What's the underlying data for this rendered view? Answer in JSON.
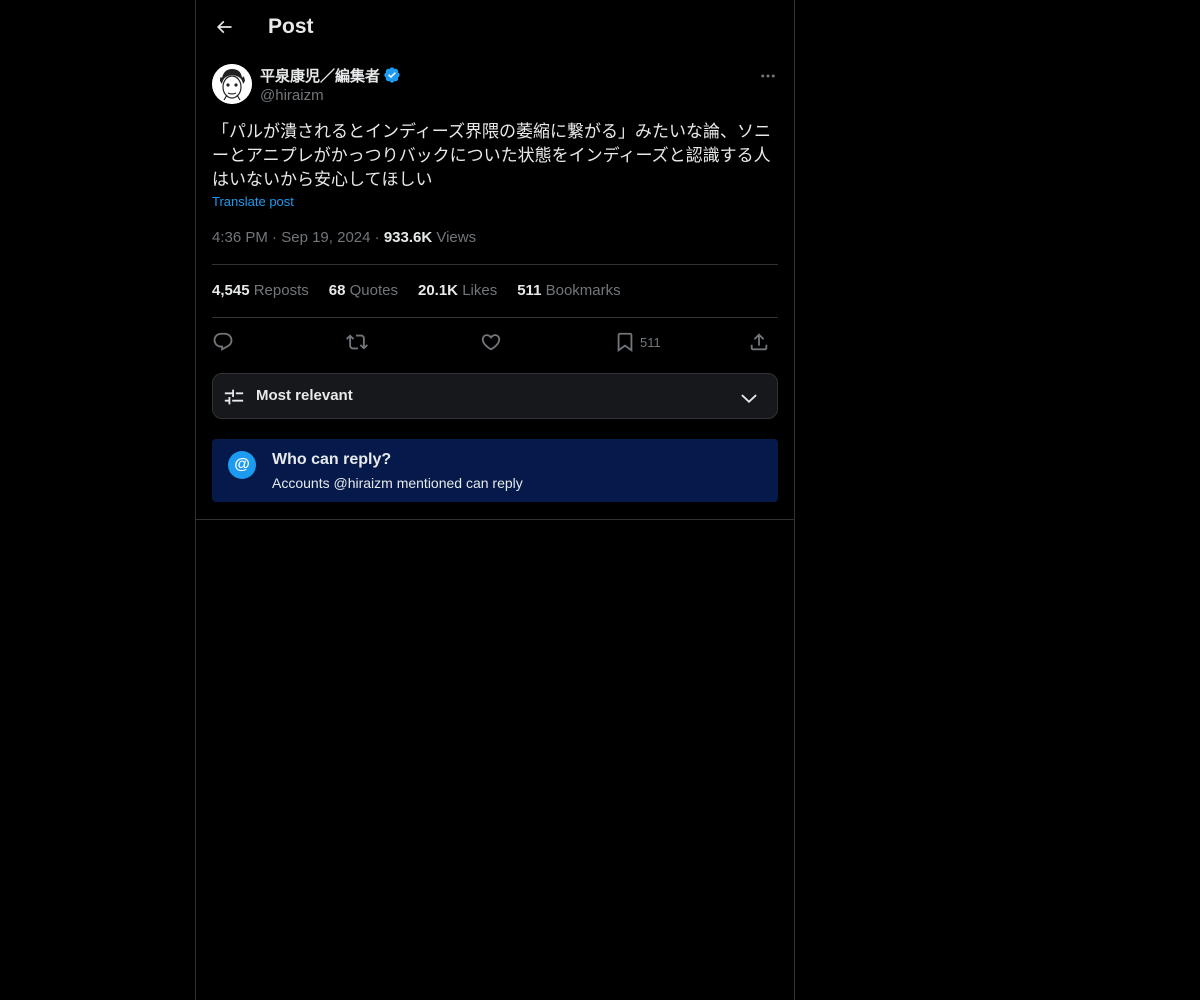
{
  "header": {
    "title": "Post",
    "back_icon": "arrow-left-icon"
  },
  "post": {
    "display_name": "平泉康児／編集者",
    "verified": true,
    "handle": "@hiraizm",
    "text": "「パルが潰されるとインディーズ界隈の萎縮に繋がる」みたいな論、ソニーとアニプレがかっつりバックについた状態をインディーズと認識する人はいないから安心してほしい",
    "translate_label": "Translate post",
    "time": "4:36 PM",
    "date": "Sep 19, 2024",
    "views_count": "933.6K",
    "views_label": "Views"
  },
  "stats": [
    {
      "num": "4,545",
      "label": "Reposts"
    },
    {
      "num": "68",
      "label": "Quotes"
    },
    {
      "num": "20.1K",
      "label": "Likes"
    },
    {
      "num": "511",
      "label": "Bookmarks"
    }
  ],
  "actions": {
    "bookmark_count": "511",
    "icons": [
      "reply-icon",
      "repost-icon",
      "like-icon",
      "bookmark-icon",
      "share-icon"
    ]
  },
  "sort": {
    "label": "Most relevant"
  },
  "reply_restriction": {
    "title": "Who can reply?",
    "description": "Accounts @hiraizm mentioned can reply"
  },
  "colors": {
    "background": "#000000",
    "accent": "#1d9bf0",
    "muted": "#71767b",
    "border": "#2f3336",
    "reply_box": "#051a4a"
  }
}
